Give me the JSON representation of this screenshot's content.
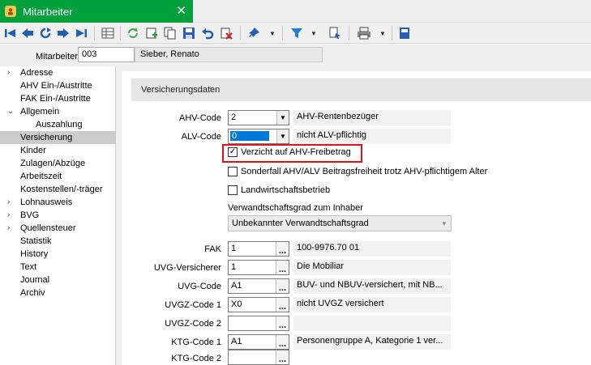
{
  "window": {
    "title": "Mitarbeiter",
    "close": "✕"
  },
  "toolbar": {
    "icons": [
      "first-record-icon",
      "prev-record-icon",
      "refresh-record-icon",
      "next-record-icon",
      "last-record-icon",
      "table-view-icon",
      "reload-icon",
      "new-record-icon",
      "copy-record-icon",
      "save-icon",
      "undo-icon",
      "delete-icon",
      "pin-icon",
      "filter-icon",
      "find-icon",
      "print-icon",
      "export-icon"
    ]
  },
  "header": {
    "employee_label": "Mitarbeiter",
    "employee_number": "003",
    "employee_name": "Sieber, Renato"
  },
  "sidebar": {
    "items": [
      {
        "label": "Adresse",
        "chevron": "›"
      },
      {
        "label": "AHV Ein-/Austritte",
        "chevron": ""
      },
      {
        "label": "FAK Ein-/Austritte",
        "chevron": ""
      },
      {
        "label": "Allgemein",
        "chevron": "⌄"
      },
      {
        "label": "Auszahlung",
        "chevron": ""
      },
      {
        "label": "Versicherung",
        "chevron": ""
      },
      {
        "label": "Kinder",
        "chevron": ""
      },
      {
        "label": "Zulagen/Abzüge",
        "chevron": ""
      },
      {
        "label": "Arbeitszeit",
        "chevron": ""
      },
      {
        "label": "Kostenstellen/-träger",
        "chevron": ""
      },
      {
        "label": "Lohnausweis",
        "chevron": "›"
      },
      {
        "label": "BVG",
        "chevron": "›"
      },
      {
        "label": "Quellensteuer",
        "chevron": "›"
      },
      {
        "label": "Statistik",
        "chevron": ""
      },
      {
        "label": "History",
        "chevron": ""
      },
      {
        "label": "Text",
        "chevron": ""
      },
      {
        "label": "Journal",
        "chevron": ""
      },
      {
        "label": "Archiv",
        "chevron": ""
      }
    ]
  },
  "section": {
    "title": "Versicherungsdaten"
  },
  "fields": {
    "ahv_code": {
      "label": "AHV-Code",
      "value": "2",
      "desc": "AHV-Rentenbezüger"
    },
    "alv_code": {
      "label": "ALV-Code",
      "value": "0",
      "desc": "nicht ALV-pflichtig"
    },
    "verzicht": {
      "label": "Verzicht auf AHV-Freibetrag",
      "checked": "✓"
    },
    "sonderfall": {
      "label": "Sonderfall AHV/ALV Beitragsfreiheit trotz AHV-pflichtigem Alter"
    },
    "landwirt": {
      "label": "Landwirtschaftsbetrieb"
    },
    "verwandt": {
      "label": "Verwandtschaftsgrad zum Inhaber",
      "value": "Unbekannter Verwandtschaftsgrad"
    },
    "fak": {
      "label": "FAK",
      "value": "1",
      "desc": "100-9976.70  01"
    },
    "uvg_versicherer": {
      "label": "UVG-Versicherer",
      "value": "1",
      "desc": "Die Mobiliar"
    },
    "uvg_code": {
      "label": "UVG-Code",
      "value": "A1",
      "desc": "BUV- und NBUV-versichert, mit NB..."
    },
    "uvgz_code1": {
      "label": "UVGZ-Code 1",
      "value": "X0",
      "desc": "nicht UVGZ versichert"
    },
    "uvgz_code2": {
      "label": "UVGZ-Code 2",
      "value": "",
      "desc": ""
    },
    "ktg_code1": {
      "label": "KTG-Code 1",
      "value": "A1",
      "desc": "Personengruppe A, Kategorie 1 ver..."
    },
    "ktg_code2": {
      "label": "KTG-Code 2",
      "value": "",
      "desc": ""
    },
    "dots": "...",
    "dropdown_arrow": "▼"
  }
}
